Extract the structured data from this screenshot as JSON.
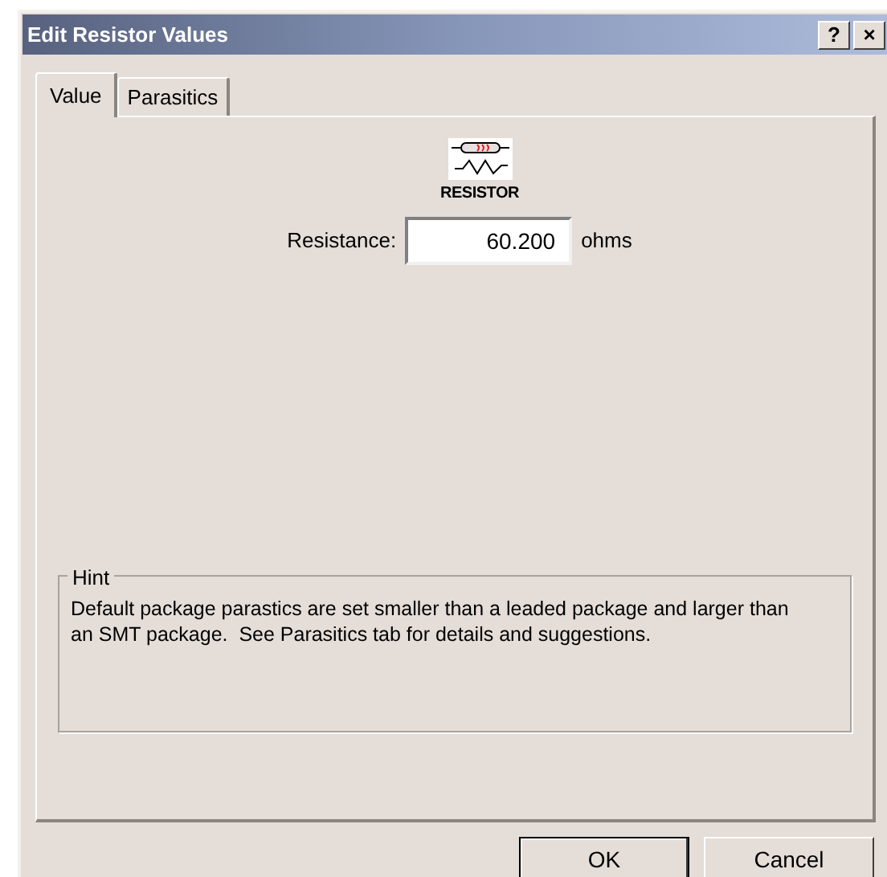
{
  "window": {
    "title": "Edit Resistor Values",
    "buttons": [
      "?",
      "×"
    ]
  },
  "tabs": [
    {
      "label": "Value",
      "selected": true
    },
    {
      "label": "Parasitics",
      "selected": false
    }
  ],
  "component": {
    "caption": "RESISTOR"
  },
  "resistance": {
    "label": "Resistance:",
    "value": "60.200",
    "unit": "ohms"
  },
  "hint": {
    "title": "Hint",
    "text": "Default package parastics are set smaller than a leaded package and larger than an SMT package.  See Parasitics tab for details and suggestions."
  },
  "buttons": [
    {
      "label": "OK",
      "default": true
    },
    {
      "label": "Cancel",
      "default": false
    }
  ]
}
